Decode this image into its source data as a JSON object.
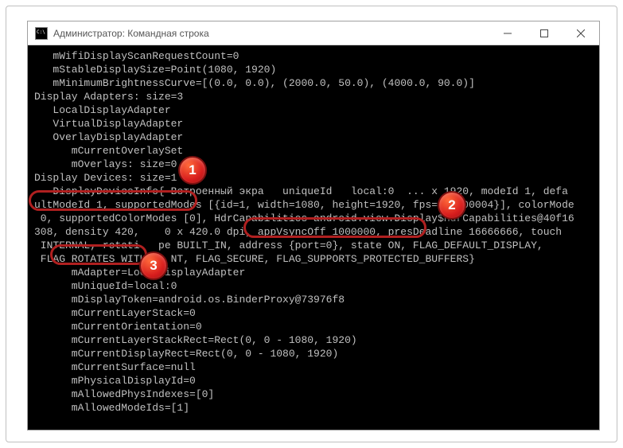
{
  "window": {
    "title": "Администратор: Командная строка"
  },
  "console": {
    "lines": [
      "   mWifiDisplayScanRequestCount=0",
      "   mStableDisplaySize=Point(1080, 1920)",
      "   mMinimumBrightnessCurve=[(0.0, 0.0), (2000.0, 50.0), (4000.0, 90.0)]",
      "",
      "Display Adapters: size=3",
      "   LocalDisplayAdapter",
      "   VirtualDisplayAdapter",
      "   OverlayDisplayAdapter",
      "      mCurrentOverlaySet",
      "      mOverlays: size=0",
      "",
      "Display Devices: size=1",
      "   DisplayDeviceInfo{ Встроенный экра   uniqueId   local:0  ... x 1920, modeId 1, defa",
      "ultModeId 1, supportedModes [{id=1, width=1080, height=1920, fps=60.000004}], colorMode",
      " 0, supportedColorModes [0], HdrCapabilities android.view.Display$HdrCapabilities@40f16",
      "308, density 420,    0 x 420.0 dpi, appVsyncOff 1000000, presDeadline 16666666, touch",
      " INTERNAL, rotati   pe BUILT_IN, address {port=0}, state ON, FLAG_DEFAULT_DISPLAY,",
      " FLAG_ROTATES_WITH_   NT, FLAG_SECURE, FLAG_SUPPORTS_PROTECTED_BUFFERS}",
      "      mAdapter=LocalDisplayAdapter",
      "      mUniqueId=local:0",
      "      mDisplayToken=android.os.BinderProxy@73976f8",
      "      mCurrentLayerStack=0",
      "      mCurrentOrientation=0",
      "      mCurrentLayerStackRect=Rect(0, 0 - 1080, 1920)",
      "      mCurrentDisplayRect=Rect(0, 0 - 1080, 1920)",
      "      mCurrentSurface=null",
      "      mPhysicalDisplayId=0",
      "      mAllowedPhysIndexes=[0]",
      "      mAllowedModeIds=[1]"
    ]
  },
  "annotations": {
    "highlight1": {
      "label": "1",
      "target": "Display Devices: size=1"
    },
    "highlight2": {
      "label": "2",
      "target": "width=1080, height=1920,"
    },
    "highlight3": {
      "label": "3",
      "target": "density 420,"
    }
  }
}
